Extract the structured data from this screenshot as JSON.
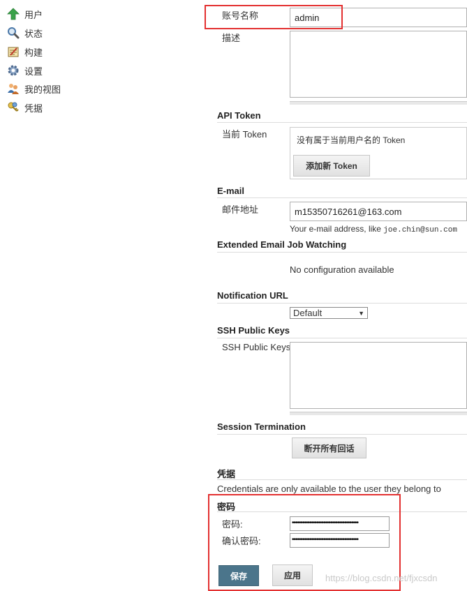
{
  "sidebar": {
    "items": [
      {
        "label": "用户",
        "icon": "up-arrow-icon"
      },
      {
        "label": "状态",
        "icon": "magnifier-icon"
      },
      {
        "label": "构建",
        "icon": "notepad-icon"
      },
      {
        "label": "设置",
        "icon": "gear-icon"
      },
      {
        "label": "我的视图",
        "icon": "people-icon"
      },
      {
        "label": "凭据",
        "icon": "keys-icon"
      }
    ]
  },
  "account": {
    "name_label": "账号名称",
    "name_value": "admin",
    "desc_label": "描述"
  },
  "api_token": {
    "title": "API Token",
    "current_label": "当前 Token",
    "none_text": "没有属于当前用户名的 Token",
    "add_button": "添加新 Token"
  },
  "email": {
    "title": "E-mail",
    "label": "邮件地址",
    "value": "m15350716261@163.com",
    "hint_text": "Your e-mail address, like ",
    "hint_example": "joe.chin@sun.com"
  },
  "ext_email": {
    "title": "Extended Email Job Watching",
    "text": "No configuration available"
  },
  "notification": {
    "title": "Notification URL",
    "select_value": "Default"
  },
  "ssh": {
    "title": "SSH Public Keys",
    "label": "SSH Public Keys"
  },
  "session": {
    "title": "Session Termination",
    "button": "断开所有回话"
  },
  "credentials": {
    "title": "凭据",
    "text": "Credentials are only available to the user they belong to"
  },
  "password": {
    "title": "密码",
    "label": "密码:",
    "confirm_label": "确认密码:",
    "masked": "••••••••••••••••••••••••••••••••••••••",
    "masked_confirm": "••••••••••••••••••••••••••••••••••••••"
  },
  "actions": {
    "save": "保存",
    "apply": "应用"
  },
  "watermark": "https://blog.csdn.net/fjxcsdn",
  "colors": {
    "highlight_border": "#e33030",
    "save_button": "#4b758b"
  }
}
